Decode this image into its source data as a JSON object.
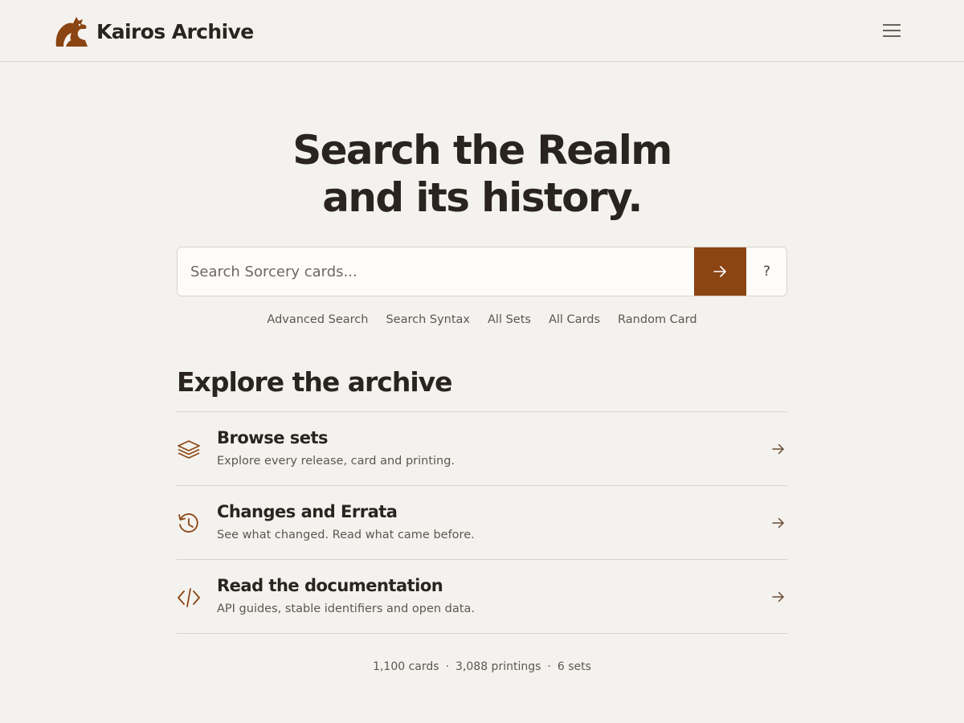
{
  "header": {
    "brand_name": "Kairos Archive",
    "logo_icon": "dragon-icon",
    "menu_icon": "hamburger-icon"
  },
  "hero": {
    "title_line1": "Search the Realm",
    "title_line2": "and its history."
  },
  "search": {
    "placeholder": "Search Sorcery cards...",
    "value": "",
    "submit_icon": "arrow-right-icon",
    "help_label": "?"
  },
  "quick_links": [
    {
      "label": "Advanced Search"
    },
    {
      "label": "Search Syntax"
    },
    {
      "label": "All Sets"
    },
    {
      "label": "All Cards"
    },
    {
      "label": "Random Card"
    }
  ],
  "explore": {
    "title": "Explore the archive",
    "items": [
      {
        "title": "Browse sets",
        "description": "Explore every release, card and printing.",
        "icon": "layers-icon"
      },
      {
        "title": "Changes and Errata",
        "description": "See what changed. Read what came before.",
        "icon": "history-icon"
      },
      {
        "title": "Read the documentation",
        "description": "API guides, stable identifiers and open data.",
        "icon": "code-icon"
      }
    ]
  },
  "stats": {
    "cards": "1,100 cards",
    "printings": "3,088 printings",
    "sets": "6 sets",
    "separator": "·"
  },
  "colors": {
    "background": "#f4f2ee",
    "accent": "#8b4513",
    "text": "#2a2420",
    "muted": "#5e5650",
    "border": "#d9d4cd"
  }
}
